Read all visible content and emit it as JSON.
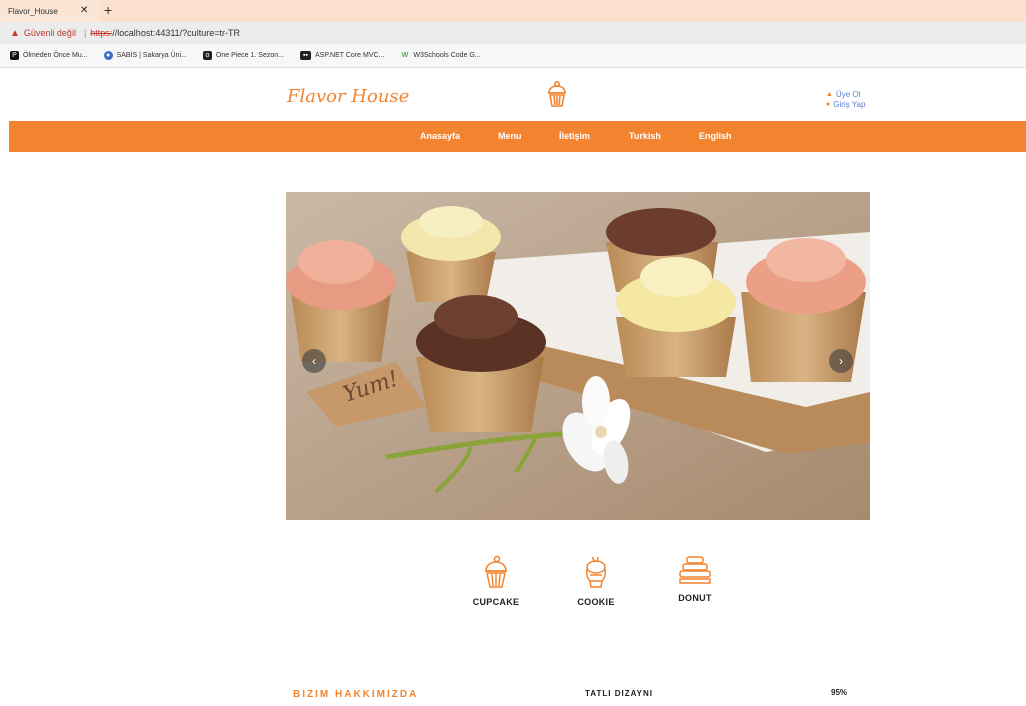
{
  "browser": {
    "tab_title": "Flavor_House",
    "tab_close": "✕",
    "new_tab": "+",
    "security_label": "Güvenli değil",
    "separator": "|",
    "url_scheme": "https:",
    "url_rest": "//localhost:44311/?culture=tr-TR",
    "bookmarks": [
      {
        "label": "Ölmeden Önce Mu...",
        "icon": "p-logo-icon",
        "color": "#111111"
      },
      {
        "label": "SABİS | Sakarya Üni...",
        "icon": "globe-icon",
        "color": "#3a6fc4"
      },
      {
        "label": "One Piece 1. Sezon...",
        "icon": "o-logo-icon",
        "color": "#222222"
      },
      {
        "label": "ASP.NET Core MVC...",
        "icon": "video-icon",
        "color": "#222222"
      },
      {
        "label": "W3Schools Code G...",
        "icon": "w3-icon",
        "color": "#4caf50"
      }
    ]
  },
  "site": {
    "logo": "Flavor House",
    "auth": {
      "register": "Üye Ol",
      "login": "Giriş Yap"
    },
    "nav": [
      {
        "label": "Anasayfa"
      },
      {
        "label": "Menu"
      },
      {
        "label": "İletişim"
      },
      {
        "label": "Turkish"
      },
      {
        "label": "English"
      }
    ],
    "carousel": {
      "prev": "‹",
      "next": "›",
      "sign_text": "Yum!"
    },
    "categories": [
      {
        "label": "CUPCAKE"
      },
      {
        "label": "COOKIE"
      },
      {
        "label": "DONUT"
      }
    ],
    "about_title": "BIZIM HAKKIMIZDA",
    "skill": {
      "label": "TATLI DIZAYNI",
      "value": "95%",
      "level": 95
    },
    "colors": {
      "accent": "#f2842f",
      "link": "#5b7fd6"
    }
  }
}
